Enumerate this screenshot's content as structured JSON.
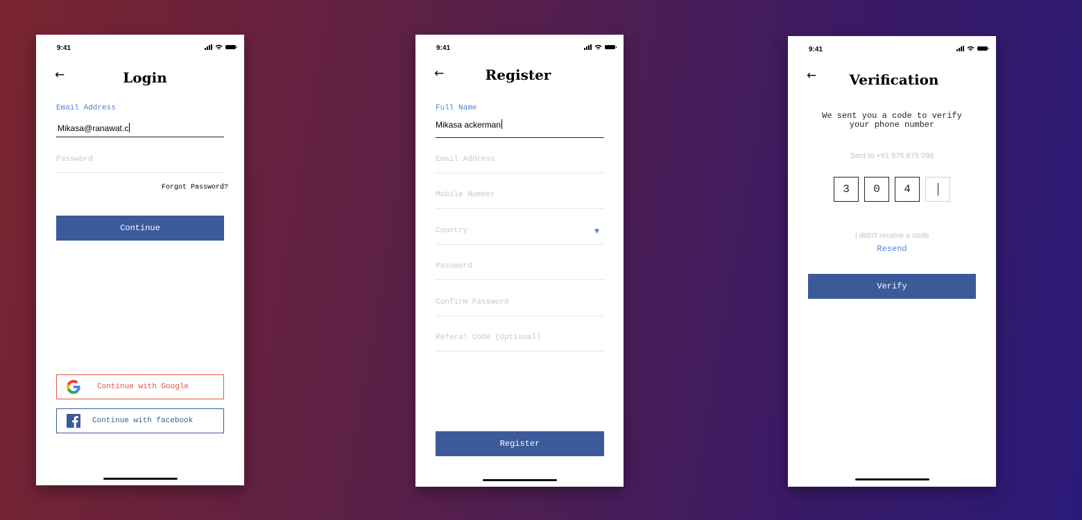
{
  "status": {
    "time": "9:41"
  },
  "login": {
    "title": "Login",
    "email_label": "Email Address",
    "email_value": "Mikasa@ranawat.c",
    "password_placeholder": "Password",
    "forgot": "Forgot Password?",
    "continue": "Continue",
    "google": "Continue with Google",
    "facebook": "Continue with facebook"
  },
  "register": {
    "title": "Register",
    "fullname_label": "Full Name",
    "fullname_value": "Mikasa ackerman",
    "email_placeholder": "Email Address",
    "mobile_placeholder": "Mobile Number",
    "country_placeholder": "Country",
    "password_placeholder": "Password",
    "confirm_placeholder": "Confirm Password",
    "referral_placeholder": "Referal Code (Optional)",
    "register": "Register"
  },
  "verify": {
    "title": "Verification",
    "message": "We sent you a code to verify your phone number",
    "sent_to": "Sent to +91 875 875 098",
    "digits": [
      "3",
      "0",
      "4",
      ""
    ],
    "no_code": "I didn't receive a code",
    "resend": "Resend",
    "verify": "Verify"
  },
  "colors": {
    "accent": "#3b5a9a",
    "label_blue": "#4a86d8",
    "google_red": "#e8533f"
  }
}
